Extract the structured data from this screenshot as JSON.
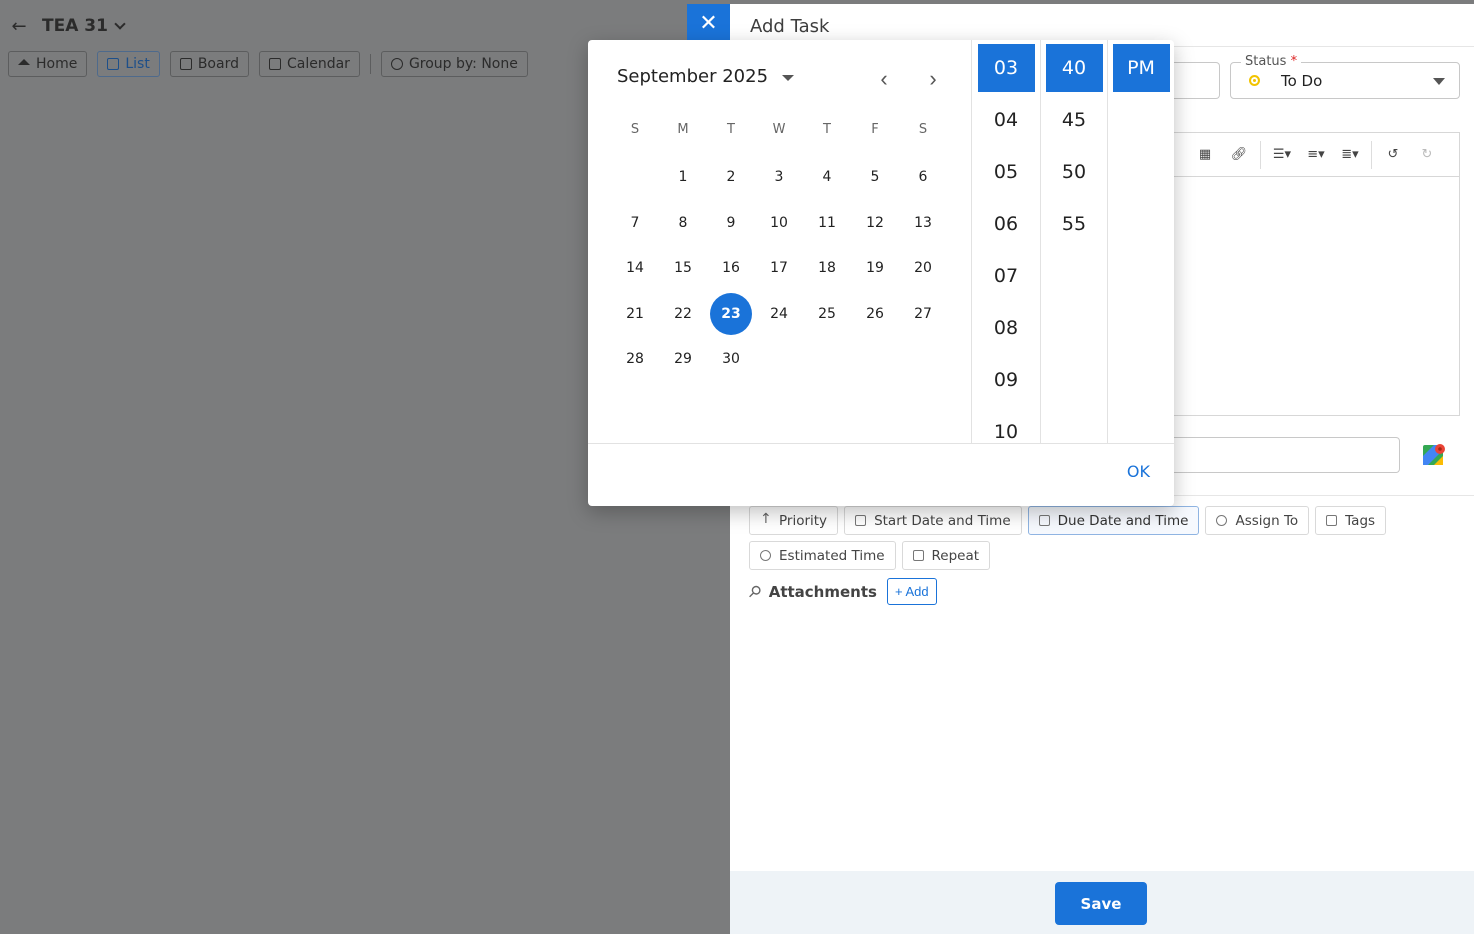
{
  "background": {
    "project_title": "TEA 31",
    "toolbar": [
      {
        "label": "Home",
        "icon": "home-icon"
      },
      {
        "label": "List",
        "icon": "list-icon",
        "active": true
      },
      {
        "label": "Board",
        "icon": "board-icon"
      },
      {
        "label": "Calendar",
        "icon": "calendar-icon"
      },
      {
        "label": "Group by: None",
        "icon": "ban-icon"
      }
    ]
  },
  "panel": {
    "close_symbol": "✕",
    "title": "Add Task",
    "status": {
      "label": "Status",
      "required_mark": "*",
      "value": "To Do",
      "dot_color": "#f2c400"
    },
    "chips": [
      {
        "label": "Priority",
        "icon": "arrow-up-icon"
      },
      {
        "label": "Start Date and Time",
        "icon": "calendar-icon"
      },
      {
        "label": "Due Date and Time",
        "icon": "calendar-icon",
        "active": true
      },
      {
        "label": "Assign To",
        "icon": "user-icon"
      },
      {
        "label": "Tags",
        "icon": "tag-icon"
      },
      {
        "label": "Estimated Time",
        "icon": "clock-icon"
      },
      {
        "label": "Repeat",
        "icon": "repeat-icon"
      }
    ],
    "attachments_label": "Attachments",
    "add_label": "+ Add",
    "save_label": "Save"
  },
  "picker": {
    "month_label": "September 2025",
    "weekdays": [
      "S",
      "M",
      "T",
      "W",
      "T",
      "F",
      "S"
    ],
    "first_weekday_offset": 1,
    "days_in_month": 30,
    "selected_day": 23,
    "hours": [
      "03",
      "04",
      "05",
      "06",
      "07",
      "08",
      "09",
      "10"
    ],
    "selected_hour": "03",
    "minutes": [
      "40",
      "45",
      "50",
      "55"
    ],
    "selected_minute": "40",
    "meridiem": [
      "PM"
    ],
    "selected_meridiem": "PM",
    "ok_label": "OK"
  },
  "colors": {
    "accent": "#1a73d9",
    "overlay": "#7b7c7d",
    "footer_bg": "#eef3f7"
  }
}
